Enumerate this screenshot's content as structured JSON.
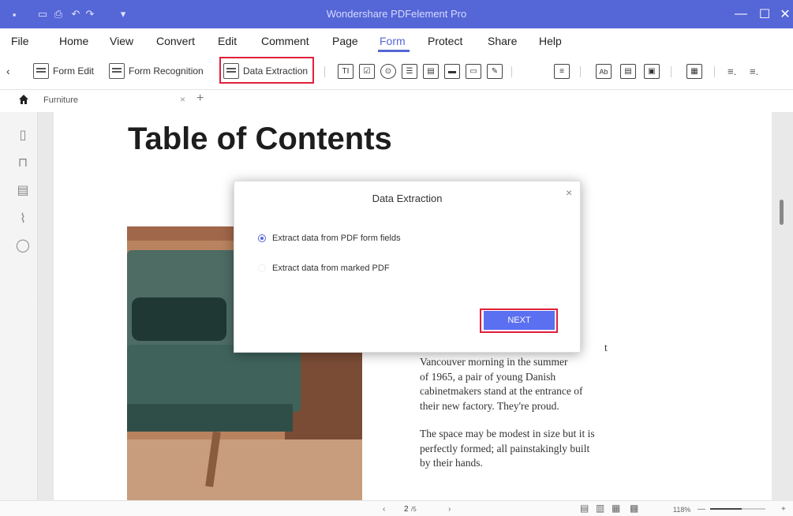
{
  "window": {
    "title": "Wondershare PDFelement Pro",
    "quick_access": [
      "▪",
      "▭",
      "⎙",
      "↶",
      "↷",
      "▾"
    ],
    "controls": {
      "minimize": "—",
      "maximize": "☐",
      "close": "✕"
    }
  },
  "menu": {
    "items": [
      "File",
      "Home",
      "View",
      "Convert",
      "Edit",
      "Comment",
      "Page",
      "Form",
      "Protect",
      "Share",
      "Help"
    ],
    "active": "Form"
  },
  "toolbar": {
    "collapse_label": "‹",
    "form_edit_label": "Form Edit",
    "form_recognition_label": "Form Recognition",
    "data_extraction_label": "Data Extraction",
    "field_icons": [
      "TI",
      "☑",
      "⊙",
      "☰",
      "▤",
      "▬",
      "▭",
      "✎"
    ],
    "more_icons": [
      "≡",
      "Ab",
      "▤",
      "▣",
      "▦",
      "≡.",
      "≡."
    ]
  },
  "tabs": {
    "home_icon": "home-icon",
    "active_tab": "Furniture",
    "close_label": "×",
    "add_label": "+"
  },
  "sidebar": {
    "icons": [
      "▯",
      "⊓",
      "▤",
      "⌇",
      "◯"
    ]
  },
  "document": {
    "heading": "Table of Contents",
    "paragraph1": [
      "Vancouver morning in the summer",
      "of 1965, a pair of young Danish",
      "cabinetmakers stand at the entrance of",
      "their new factory. They're proud."
    ],
    "paragraph1_partial": "t",
    "paragraph2": [
      "The space may be modest in size but it is",
      "perfectly formed; all painstakingly built",
      "by their hands."
    ]
  },
  "dialog": {
    "title": "Data Extraction",
    "close_label": "×",
    "option1": "Extract data from PDF form fields",
    "option2": "Extract data from marked PDF",
    "selected": "option1",
    "next_label": "NEXT"
  },
  "status": {
    "prev_label": "‹",
    "page_current": "2",
    "page_total": "/5",
    "next_label": "›",
    "zoom": "118%",
    "zoom_out": "—",
    "zoom_in": "+"
  },
  "colors": {
    "brand": "#5566d6",
    "highlight": "#e0203a",
    "button": "#5b6ff1"
  }
}
